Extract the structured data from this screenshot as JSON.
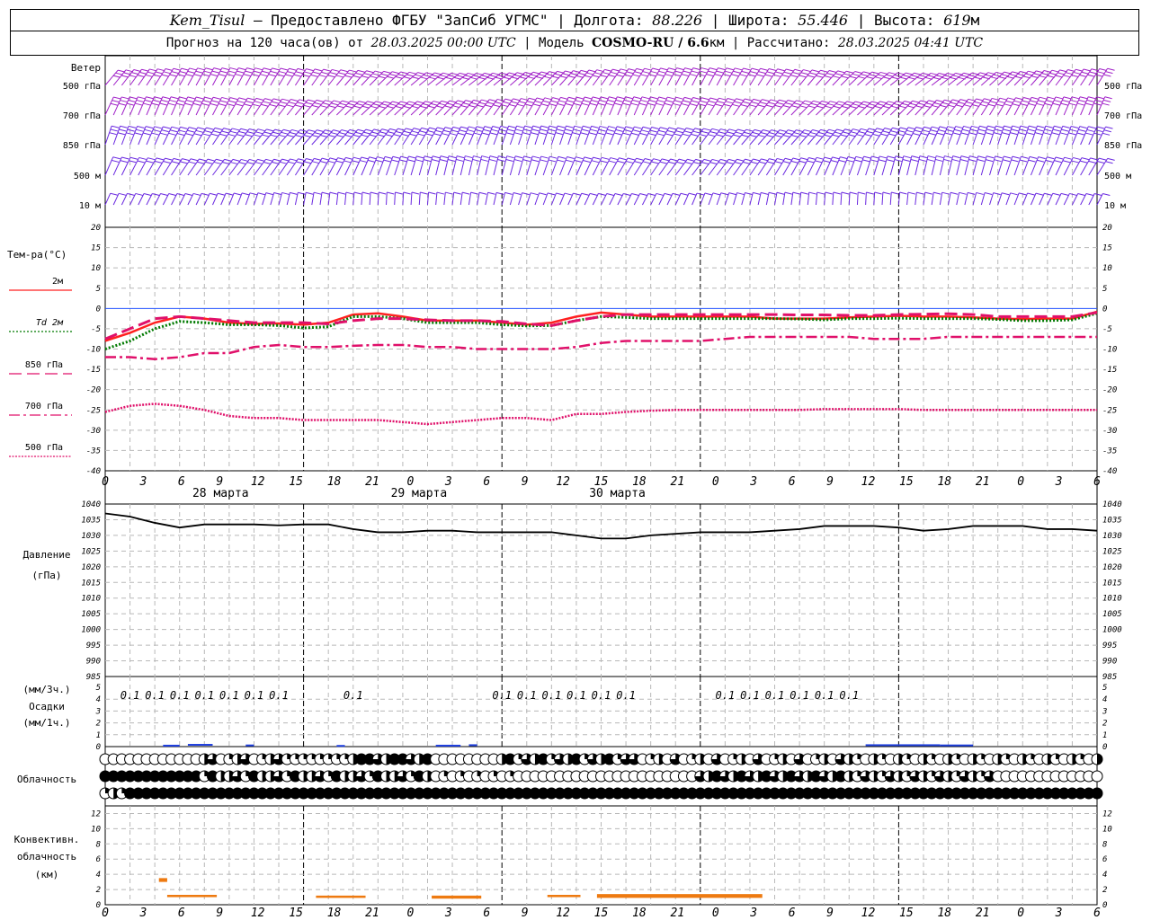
{
  "header": {
    "station": "Kem_Tisul",
    "dash": "—",
    "provider": "Предоставлено ФГБУ \"ЗапСиб УГМС\"",
    "lon_label": "Долгота:",
    "lon": "88.226",
    "lat_label": "Широта:",
    "lat": "55.446",
    "alt_label": "Высота:",
    "alt": "619",
    "alt_unit": "м",
    "fc_label": "Прогноз на 120 часа(ов) от",
    "fc_start": "28.03.2025 00:00 UTC",
    "model_label": "Модель",
    "model": "COSMO-RU / 6.6",
    "model_unit": "км",
    "calc_label": "Рассчитано:",
    "calc": "28.03.2025 04:41 UTC"
  },
  "wind_panel": {
    "title": "Ветер",
    "levels": [
      "500 гПа",
      "700 гПа",
      "850 гПа",
      "500 м",
      "10  м"
    ],
    "colors": {
      "upper": "#a020c8",
      "lower": "#6a28e0"
    }
  },
  "temp_panel": {
    "title": "Тем-ра(°С)",
    "legend": [
      {
        "label": "2м",
        "color": "#ff2020",
        "style": "solid"
      },
      {
        "label": "Td  2м",
        "color": "#007a00",
        "style": "dotted"
      },
      {
        "label": "850 гПа",
        "color": "#e0106a",
        "style": "dash"
      },
      {
        "label": "700 гПа",
        "color": "#e0106a",
        "style": "dashdot"
      },
      {
        "label": "500 гПа",
        "color": "#e0106a",
        "style": "dot"
      }
    ],
    "yticks": [
      "20",
      "15",
      "10",
      "5",
      "0",
      "-5",
      "-10",
      "-15",
      "-20",
      "-25",
      "-30",
      "-35",
      "-40"
    ]
  },
  "time_axis": {
    "ticks": [
      "0",
      "3",
      "6",
      "9",
      "12",
      "15",
      "18",
      "21",
      "0",
      "3",
      "6",
      "9",
      "12",
      "15",
      "18",
      "21",
      "0",
      "3",
      "6",
      "9",
      "12",
      "15",
      "18",
      "21",
      "0",
      "3",
      "6"
    ],
    "days": [
      "28 марта",
      "29 марта",
      "30 марта"
    ]
  },
  "pressure_panel": {
    "title": "Давление",
    "unit": "(гПа)",
    "yticks": [
      "1040",
      "1035",
      "1030",
      "1025",
      "1020",
      "1015",
      "1010",
      "1005",
      "1000",
      "995",
      "990",
      "985"
    ]
  },
  "precip_panel": {
    "title": "Осадки",
    "unit3": "(мм/3ч.)",
    "unit1": "(мм/1ч.)",
    "yticks": [
      "5",
      "4",
      "3",
      "2",
      "1",
      "0"
    ],
    "labels_text": "0.1",
    "labels_hours": [
      3,
      6,
      9,
      12,
      15,
      18,
      21,
      30,
      48,
      51,
      54,
      57,
      60,
      63,
      75,
      78,
      81,
      84,
      87,
      90
    ]
  },
  "cloud_panel": {
    "title": "Облачность"
  },
  "conv_panel": {
    "title1": "Конвективн.",
    "title2": "облачность",
    "unit": "(км)",
    "yticks": [
      "12",
      "10",
      "8",
      "6",
      "4",
      "2",
      "0"
    ],
    "color": "#ee7a10"
  },
  "chart_data": [
    {
      "type": "line",
      "title": "Тем-ра(°С)",
      "ylim": [
        -40,
        20
      ],
      "x_hours": [
        0,
        3,
        6,
        9,
        12,
        15,
        18,
        21,
        24,
        27,
        30,
        33,
        36,
        39,
        42,
        45,
        48,
        51,
        54,
        57,
        60,
        63,
        66,
        69,
        72,
        75,
        78,
        81,
        84,
        87,
        90,
        93,
        96,
        99,
        102,
        105,
        108,
        111,
        114,
        117,
        120
      ],
      "series": [
        {
          "name": "2м",
          "values": [
            -8,
            -6,
            -3.5,
            -2,
            -2.5,
            -3.5,
            -3.8,
            -3.7,
            -4,
            -3.5,
            -1.5,
            -1.2,
            -2,
            -3,
            -3,
            -3,
            -3.5,
            -4,
            -3.5,
            -2,
            -1,
            -1.5,
            -2,
            -2,
            -2,
            -2,
            -2,
            -2.5,
            -2.5,
            -2.5,
            -2.2,
            -2,
            -1.8,
            -2,
            -2,
            -2.2,
            -2.5,
            -2.6,
            -2.5,
            -2.5,
            -0.8
          ]
        },
        {
          "name": "Td  2м",
          "values": [
            -10,
            -8,
            -5,
            -3.2,
            -3.5,
            -4,
            -4,
            -4.2,
            -4.8,
            -4.5,
            -2,
            -2,
            -2.5,
            -3.5,
            -3.5,
            -3.5,
            -4,
            -4.3,
            -4.2,
            -3,
            -2,
            -2.2,
            -2.5,
            -2.5,
            -2.5,
            -2.5,
            -2.5,
            -2.5,
            -2.6,
            -2.8,
            -2.5,
            -2.5,
            -2.4,
            -2.5,
            -2.5,
            -2.5,
            -2.7,
            -3,
            -3,
            -2.8,
            -1.2
          ]
        },
        {
          "name": "850 гПа",
          "values": [
            -7.5,
            -5,
            -2.5,
            -2,
            -2.5,
            -3,
            -3.5,
            -3.5,
            -3.5,
            -3.8,
            -3,
            -2.5,
            -2.5,
            -2.8,
            -3,
            -3,
            -3.2,
            -3.8,
            -4.2,
            -3,
            -2,
            -1.5,
            -1.5,
            -1.5,
            -1.5,
            -1.5,
            -1.5,
            -1.5,
            -1.6,
            -1.6,
            -1.7,
            -1.7,
            -1.5,
            -1.4,
            -1.3,
            -1.5,
            -2,
            -2,
            -2,
            -2,
            -1
          ]
        },
        {
          "name": "700 гПа",
          "values": [
            -12,
            -12,
            -12.5,
            -12,
            -11,
            -11,
            -9.5,
            -9,
            -9.5,
            -9.5,
            -9.2,
            -9,
            -9,
            -9.5,
            -9.5,
            -10,
            -10,
            -10,
            -10,
            -9.5,
            -8.5,
            -8,
            -8,
            -8,
            -8,
            -7.5,
            -7,
            -7,
            -7,
            -7,
            -7,
            -7.5,
            -7.5,
            -7.5,
            -7,
            -7,
            -7,
            -7,
            -7,
            -7,
            -7
          ]
        },
        {
          "name": "500 гПа",
          "values": [
            -25.5,
            -24,
            -23.5,
            -24,
            -25,
            -26.5,
            -27,
            -27,
            -27.5,
            -27.5,
            -27.5,
            -27.5,
            -28,
            -28.5,
            -28,
            -27.5,
            -27,
            -27,
            -27.5,
            -26,
            -26,
            -25.5,
            -25.2,
            -25,
            -25,
            -25,
            -25,
            -25,
            -25,
            -24.8,
            -24.8,
            -24.8,
            -24.8,
            -25,
            -25,
            -25,
            -25,
            -25,
            -25,
            -25,
            -25
          ]
        }
      ]
    },
    {
      "type": "line",
      "title": "Давление",
      "ylim": [
        985,
        1040
      ],
      "x_hours": [
        0,
        3,
        6,
        9,
        12,
        15,
        18,
        21,
        24,
        27,
        30,
        33,
        36,
        39,
        42,
        45,
        48,
        51,
        54,
        57,
        60,
        63,
        66,
        69,
        72,
        75,
        78,
        81,
        84,
        87,
        90,
        93,
        96,
        99,
        102,
        105,
        108,
        111,
        114,
        117,
        120
      ],
      "series": [
        {
          "name": "Давление",
          "values": [
            1037,
            1036,
            1034,
            1032.5,
            1033.5,
            1033.5,
            1033.5,
            1033.2,
            1033.5,
            1033.5,
            1032,
            1031,
            1031,
            1031.5,
            1031.5,
            1031,
            1031,
            1031,
            1031,
            1030,
            1029,
            1029,
            1030,
            1030.5,
            1031,
            1031,
            1031,
            1031.5,
            1032,
            1033,
            1033,
            1033,
            1032.5,
            1031.5,
            1032,
            1033,
            1033,
            1033,
            1032,
            1032,
            1031.5
          ]
        }
      ]
    },
    {
      "type": "bar",
      "title": "Осадки",
      "ylim": [
        0,
        5
      ],
      "bars": [
        {
          "from_h": 7,
          "to_h": 9,
          "value": 0.08
        },
        {
          "from_h": 10,
          "to_h": 13,
          "value": 0.15
        },
        {
          "from_h": 17,
          "to_h": 18,
          "value": 0.1
        },
        {
          "from_h": 28,
          "to_h": 29,
          "value": 0.06
        },
        {
          "from_h": 40,
          "to_h": 43,
          "value": 0.08
        },
        {
          "from_h": 44,
          "to_h": 45,
          "value": 0.12
        },
        {
          "from_h": 92,
          "to_h": 101,
          "value": 0.12
        },
        {
          "from_h": 101,
          "to_h": 105,
          "value": 0.1
        }
      ]
    },
    {
      "type": "bar",
      "title": "Конвективн. облачность",
      "ylim": [
        0,
        13
      ],
      "bars": [
        {
          "from_h": 6.5,
          "to_h": 7.5,
          "bottom": 3,
          "top": 3.5
        },
        {
          "from_h": 7.5,
          "to_h": 13.5,
          "bottom": 1,
          "top": 1.3
        },
        {
          "from_h": 25.5,
          "to_h": 31.5,
          "bottom": 0.9,
          "top": 1.2
        },
        {
          "from_h": 39.5,
          "to_h": 45.5,
          "bottom": 0.8,
          "top": 1.2
        },
        {
          "from_h": 53.5,
          "to_h": 57.5,
          "bottom": 1,
          "top": 1.3
        },
        {
          "from_h": 59.5,
          "to_h": 79.5,
          "bottom": 0.9,
          "top": 1.4
        }
      ]
    }
  ]
}
